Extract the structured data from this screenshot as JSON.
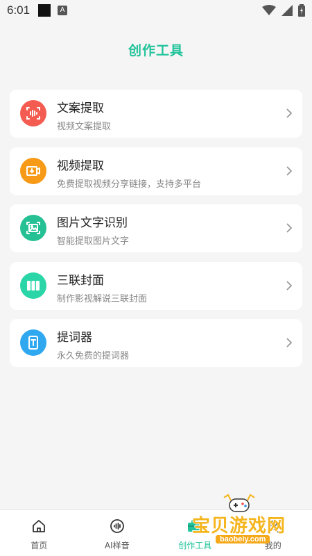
{
  "status_bar": {
    "time": "6:01",
    "a_badge": "A"
  },
  "page": {
    "title": "创作工具"
  },
  "tools": [
    {
      "title": "文案提取",
      "subtitle": "视频文案提取",
      "icon": "audio-wave-icon",
      "color": "#f45c52"
    },
    {
      "title": "视频提取",
      "subtitle": "免费提取视频分享链接，支持多平台",
      "icon": "video-download-icon",
      "color": "#f79a18"
    },
    {
      "title": "图片文字识别",
      "subtitle": "智能提取图片文字",
      "icon": "image-scan-icon",
      "color": "#25c195"
    },
    {
      "title": "三联封面",
      "subtitle": "制作影视解说三联封面",
      "icon": "triple-panel-icon",
      "color": "#2ad6a8"
    },
    {
      "title": "提词器",
      "subtitle": "永久免费的提词器",
      "icon": "teleprompter-icon",
      "color": "#30a8f0"
    }
  ],
  "nav": {
    "items": [
      {
        "label": "首页",
        "icon": "home-icon"
      },
      {
        "label": "AI样音",
        "icon": "voice-icon"
      },
      {
        "label": "创作工具",
        "icon": "toolbox-icon",
        "active": true
      },
      {
        "label": "我的",
        "icon": "profile-icon"
      }
    ]
  },
  "watermark": {
    "text": "宝贝游戏网",
    "url": "baobeiy.com"
  },
  "colors": {
    "accent": "#21c39a",
    "background": "#f5f5f5"
  }
}
